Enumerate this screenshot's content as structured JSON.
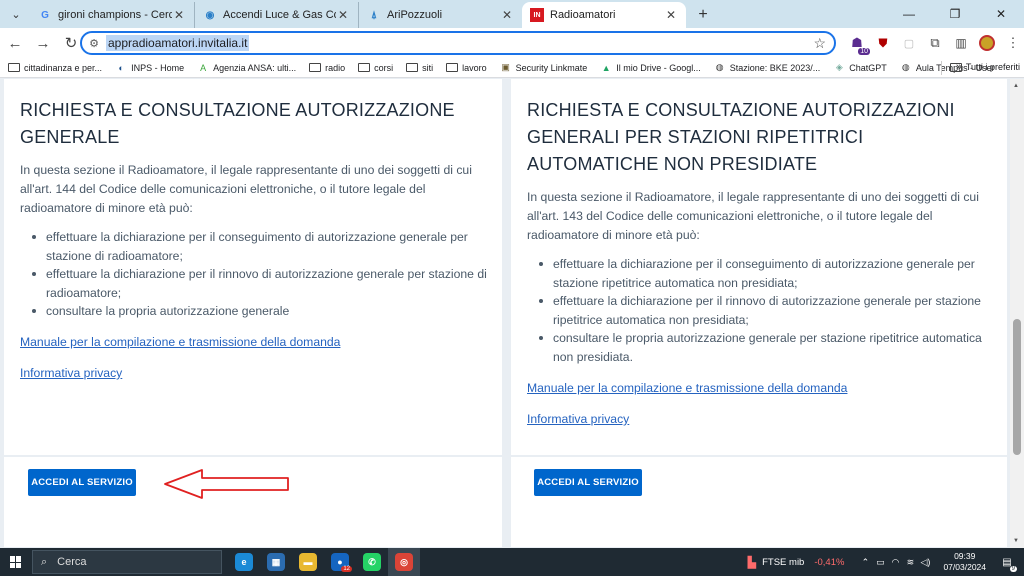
{
  "tabs": [
    {
      "title": "gironi champions - Cerca con G",
      "icon": "google-icon",
      "color": "#4285f4",
      "glyph": "G"
    },
    {
      "title": "Accendi Luce & Gas Coop: il for",
      "icon": "coop-icon",
      "color": "#2a7fc8",
      "glyph": "◉"
    },
    {
      "title": "AriPozzuoli",
      "icon": "antenna-icon",
      "color": "#2a7fc8",
      "glyph": "⍋"
    },
    {
      "title": "Radioamatori",
      "icon": "invitalia-icon",
      "color": "#d71920",
      "glyph": "IN",
      "active": true
    }
  ],
  "window": {
    "new_tab": "+",
    "minimize": "—",
    "restore": "❐",
    "close": "✕"
  },
  "toolbar": {
    "back": "←",
    "forward": "→",
    "reload": "↻",
    "url": "appradioamatori.invitalia.it",
    "star": "☆",
    "ext_badge": "10"
  },
  "bookmarks": [
    {
      "label": "cittadinanza e  per...",
      "icon": "folder"
    },
    {
      "label": "INPS - Home",
      "icon": "inps-icon",
      "glyph": "◐",
      "color": "#1a4f8b"
    },
    {
      "label": "Agenzia ANSA: ulti...",
      "icon": "ansa-icon",
      "glyph": "A",
      "color": "#3aa53a"
    },
    {
      "label": "radio",
      "icon": "folder"
    },
    {
      "label": "corsi",
      "icon": "folder"
    },
    {
      "label": "siti",
      "icon": "folder"
    },
    {
      "label": "lavoro",
      "icon": "folder"
    },
    {
      "label": "Security Linkmate",
      "icon": "linkmate-icon",
      "glyph": "▣",
      "color": "#6b5a2e"
    },
    {
      "label": "Il mio Drive - Googl...",
      "icon": "drive-icon",
      "glyph": "▲",
      "color": "#1fa463"
    },
    {
      "label": "Stazione: BKE 2023/...",
      "icon": "globe-icon",
      "glyph": "◍",
      "color": "#333333"
    },
    {
      "label": "ChatGPT",
      "icon": "chatgpt-icon",
      "glyph": "◈",
      "color": "#74aa9c"
    },
    {
      "label": "Aula Tempus - User",
      "icon": "globe-icon",
      "glyph": "◍",
      "color": "#333333"
    }
  ],
  "bookmarks_more": "»",
  "bookmarks_all": "Tutti i preferiti",
  "left_card": {
    "title": "RICHIESTA E CONSULTAZIONE AUTORIZZAZIONE GENERALE",
    "intro": "In questa sezione il Radioamatore, il legale rappresentante di uno dei soggetti di cui all'art. 144 del Codice delle comunicazioni elettroniche, o il tutore legale del radioamatore di minore età può:",
    "items": [
      "effettuare la dichiarazione per il conseguimento di autorizzazione generale per stazione di radioamatore;",
      "effettuare la dichiarazione per il rinnovo di autorizzazione generale per stazione di radioamatore;",
      "consultare la propria autorizzazione generale"
    ],
    "manual_link": "Manuale per la compilazione e trasmissione della domanda",
    "privacy_link": "Informativa privacy",
    "button": "ACCEDI AL SERVIZIO"
  },
  "right_card": {
    "title": "RICHIESTA E CONSULTAZIONE AUTORIZZAZIONI GENERALI PER STAZIONI RIPETITRICI AUTOMATICHE NON PRESIDIATE",
    "intro": "In questa sezione il Radioamatore, il legale rappresentante di uno dei soggetti di cui all'art. 143 del Codice delle comunicazioni elettroniche, o il tutore legale del radioamatore di minore età può:",
    "items": [
      "effettuare la dichiarazione per il conseguimento di autorizzazione generale per stazione ripetitrice automatica non presidiata;",
      "effettuare la dichiarazione per il rinnovo di autorizzazione generale per stazione ripetitrice automatica non presidiata;",
      "consultare le propria autorizzazione generale per stazione ripetitrice automatica non presidiata."
    ],
    "manual_link": "Manuale per la compilazione e trasmissione della domanda",
    "privacy_link": "Informativa privacy",
    "button": "ACCEDI AL SERVIZIO"
  },
  "annotation": {
    "color": "#e02020"
  },
  "taskbar": {
    "search_placeholder": "Cerca",
    "apps": [
      {
        "name": "taskbar-edge",
        "glyph": "e",
        "color": "#1b8ad6"
      },
      {
        "name": "taskbar-store",
        "glyph": "▦",
        "color": "#2b6cb0"
      },
      {
        "name": "taskbar-explorer",
        "glyph": "▬",
        "color": "#e8b830"
      },
      {
        "name": "taskbar-outlook",
        "glyph": "●",
        "color": "#1565c0",
        "badge": "12"
      },
      {
        "name": "taskbar-whatsapp",
        "glyph": "✆",
        "color": "#25d366"
      },
      {
        "name": "taskbar-chrome",
        "glyph": "◎",
        "color": "#db4437",
        "active": true
      }
    ],
    "ticker_name": "FTSE mib",
    "ticker_change": "-0,41%",
    "time": "09:39",
    "date": "07/03/2024",
    "notif_badge": "9"
  }
}
